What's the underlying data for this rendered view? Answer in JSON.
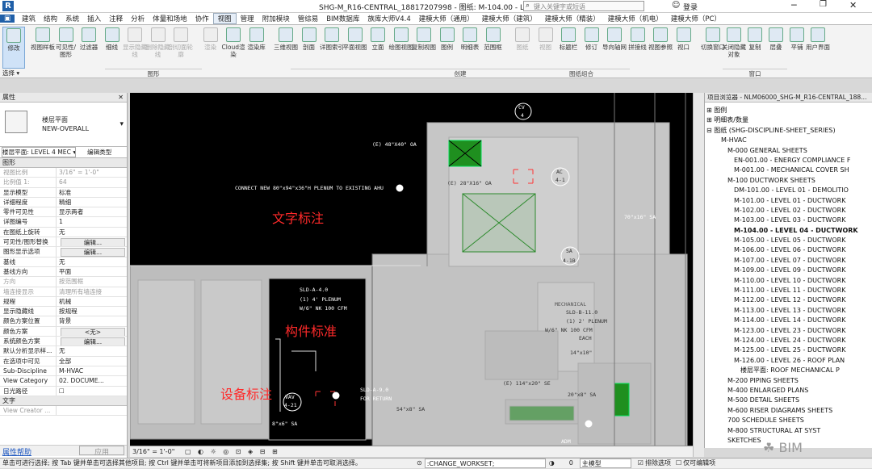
{
  "title": "SHG-M_R16-CENTRAL_18817207998 - 图纸: M-104.00 - LE...",
  "search_placeholder": "键入关键字或短语",
  "login": "登录",
  "menu": [
    "建筑",
    "结构",
    "系统",
    "插入",
    "注释",
    "分析",
    "体量和场地",
    "协作",
    "视图",
    "管理",
    "附加模块",
    "管综易",
    "BIM数据库",
    "族库大师V4.4",
    "建模大师（通用）",
    "建模大师（建筑）",
    "建模大师（精装）",
    "建模大师（机电）",
    "建模大师（PC）"
  ],
  "ribbon": {
    "modify": "修改",
    "select": "选择 ▾",
    "buttons": [
      "视图样板",
      "可见性/图形",
      "过滤器",
      "细线",
      "显示隐藏线",
      "删除隐藏线",
      "剖切面轮廓",
      "渲染",
      "Cloud渲染",
      "渲染库",
      "三维视图",
      "剖面",
      "详图索引",
      "平面视图",
      "立面",
      "绘图视图",
      "复制视图",
      "图例",
      "明细表",
      "范围框",
      "图纸",
      "视图",
      "标题栏",
      "修订",
      "导向轴网",
      "拼接线",
      "视图参照",
      "视口",
      "切换窗口",
      "关闭隐藏对象",
      "复制",
      "层叠",
      "平铺",
      "用户界面"
    ],
    "groups": [
      "图形",
      "创建",
      "图纸组合",
      "窗口"
    ]
  },
  "properties": {
    "header": "属性",
    "type_family": "楼层平面",
    "type_name": "NEW-OVERALL",
    "selector": "楼层平面: LEVEL 4 MEC ▾",
    "edit_type": "编辑类型",
    "section": "图形",
    "rows": [
      [
        "视图比例",
        "3/16\" = 1'-0\""
      ],
      [
        "比例值 1:",
        "64"
      ],
      [
        "显示模型",
        "标准"
      ],
      [
        "详细程度",
        "精细"
      ],
      [
        "零件可见性",
        "显示两者"
      ],
      [
        "详图编号",
        "1"
      ],
      [
        "在图纸上旋转",
        "无"
      ],
      [
        "可见性/图形替换",
        "编辑..."
      ],
      [
        "图形显示选项",
        "编辑..."
      ],
      [
        "基线",
        "无"
      ],
      [
        "基线方向",
        "平面"
      ],
      [
        "方向",
        "按范围框"
      ],
      [
        "墙连接显示",
        "清理所有墙连接"
      ],
      [
        "规程",
        "机械"
      ],
      [
        "显示隐藏线",
        "按规程"
      ],
      [
        "颜色方案位置",
        "背景"
      ],
      [
        "颜色方案",
        "<无>"
      ],
      [
        "系统颜色方案",
        "编辑..."
      ],
      [
        "默认分析显示样...",
        "无"
      ],
      [
        "在选项中可见",
        "全部"
      ],
      [
        "Sub-Discipline",
        "M-HVAC"
      ],
      [
        "View Category",
        "02. DOCUME..."
      ],
      [
        "日光路径",
        "☐"
      ]
    ],
    "section2": "文字",
    "view_creator": "View Creator ...",
    "help": "属性帮助",
    "apply": "应用"
  },
  "canvas": {
    "annotations": [
      "文字标注",
      "构件标准",
      "设备标注"
    ],
    "labels": {
      "connect": "CONNECT NEW 80\"x94\"x36\"H PLENUM TO EXISTING AHU",
      "oa1": "(E) 48\"X40\" OA",
      "oa2": "(E) 28\"X16\" OA",
      "cv": "CV",
      "cv_n": "4",
      "ac": "AC",
      "ac_n": "4-1",
      "sa": "SA",
      "sa_n": "4-1B",
      "sld1": "SLD-A-4.0",
      "plenum1": "(1) 4' PLENUM",
      "cfm1": "W/6\" NK 100 CFM",
      "sld2": "SLD-B-11.0",
      "plenum2": "(1) 2' PLENUM",
      "cfm2": "W/6\" NK 100 CFM",
      "each": "EACH",
      "sld3": "SLD-A-9.0",
      "return": "FOR RETURN",
      "vav": "VAV",
      "vav_n": "4-21",
      "sa70": "70\"x16\" SA",
      "sa114": "(E) 114\"x20\" SE",
      "sa14": "14\"x10\"",
      "sa20": "20\"x8\" SA",
      "sa54": "54\"x8\" SA",
      "sa8": "8\"x6\" SA",
      "adm": "ADM",
      "mechanical": "MECHANICAL"
    },
    "scale": "3/16\" = 1'-0\""
  },
  "browser": {
    "header": "项目浏览器 - NLM06000_SHG-M_R16-CENTRAL_188...",
    "items": [
      "⊞ 图例",
      "⊞ 明细表/数量",
      "⊟ 图纸 (SHG-DISCIPLINE-SHEET_SERIES)",
      "M-HVAC",
      "M-000 GENERAL SHEETS",
      "EN-001.00 - ENERGY COMPLIANCE F",
      "M-001.00 - MECHANICAL COVER SH",
      "M-100 DUCTWORK SHEETS",
      "DM-101.00 - LEVEL 01 - DEMOLITIO",
      "M-101.00 - LEVEL 01 - DUCTWORK",
      "M-102.00 - LEVEL 02 - DUCTWORK",
      "M-103.00 - LEVEL 03 - DUCTWORK",
      "M-104.00 - LEVEL 04 - DUCTWORK",
      "M-105.00 - LEVEL 05 - DUCTWORK",
      "M-106.00 - LEVEL 06 - DUCTWORK",
      "M-107.00 - LEVEL 07 - DUCTWORK",
      "M-109.00 - LEVEL 09 - DUCTWORK",
      "M-110.00 - LEVEL 10 - DUCTWORK",
      "M-111.00 - LEVEL 11 - DUCTWORK",
      "M-112.00 - LEVEL 12 - DUCTWORK",
      "M-113.00 - LEVEL 13 - DUCTWORK",
      "M-114.00 - LEVEL 14 - DUCTWORK",
      "M-123.00 - LEVEL 23 - DUCTWORK",
      "M-124.00 - LEVEL 24 - DUCTWORK",
      "M-125.00 - LEVEL 25 - DUCTWORK",
      "M-126.00 - LEVEL 26 - ROOF PLAN",
      "楼层平面: ROOF MECHANICAL P",
      "M-200 PIPING SHEETS",
      "M-400 ENLARGED PLANS",
      "M-500 DETAIL SHEETS",
      "M-600 RISER DIAGRAMS SHEETS",
      "700 SCHEDULE SHEETS",
      "M-800 STRUCTURAL AT SYST",
      "SKETCHES"
    ]
  },
  "status": {
    "hint": "单击可进行选择; 按 Tab 键并单击可选择其他项目; 按 Ctrl 键并单击可将新项目添加到选择集; 按 Shift 键并单击可取消选择。",
    "workset": ":CHANGE_WORKSET;",
    "zero": "0",
    "model": "主模型",
    "exclude": "排除选项",
    "editable": "仅可编辑项",
    "watermark": "BIM"
  }
}
